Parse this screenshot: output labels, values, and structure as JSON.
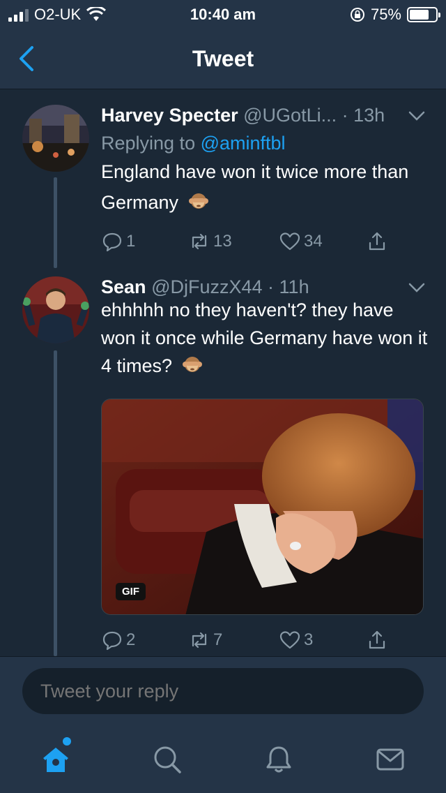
{
  "status_bar": {
    "carrier": "O2-UK",
    "time": "10:40 am",
    "battery": "75%",
    "battery_level": 0.75
  },
  "nav": {
    "title": "Tweet",
    "back_icon": "chevron-left-icon"
  },
  "tweets": [
    {
      "name": "Harvey Specter",
      "handle": "@UGotLi...",
      "time": "· 13h",
      "replying_prefix": "Replying to ",
      "replying_to": "@aminftbl",
      "text": "England have won it twice more than Germany",
      "emoji": "see-no-evil-monkey",
      "replies": "1",
      "retweets": "13",
      "likes": "34"
    },
    {
      "name": "Sean",
      "handle": "@DjFuzzX44",
      "time": "· 11h",
      "text": "ehhhhh no they haven't? they have won it once while Germany have won it 4 times?",
      "emoji": "see-no-evil-monkey",
      "media_badge": "GIF",
      "replies": "2",
      "retweets": "7",
      "likes": "3"
    }
  ],
  "reply_box": {
    "placeholder": "Tweet your reply"
  },
  "tab_bar": {
    "items": [
      "home-icon",
      "search-icon",
      "notifications-icon",
      "messages-icon"
    ],
    "accent": "#1da1f2"
  },
  "colors": {
    "background": "#1b2836",
    "bar": "#243447",
    "muted": "#8899a6",
    "link": "#1da1f2"
  }
}
